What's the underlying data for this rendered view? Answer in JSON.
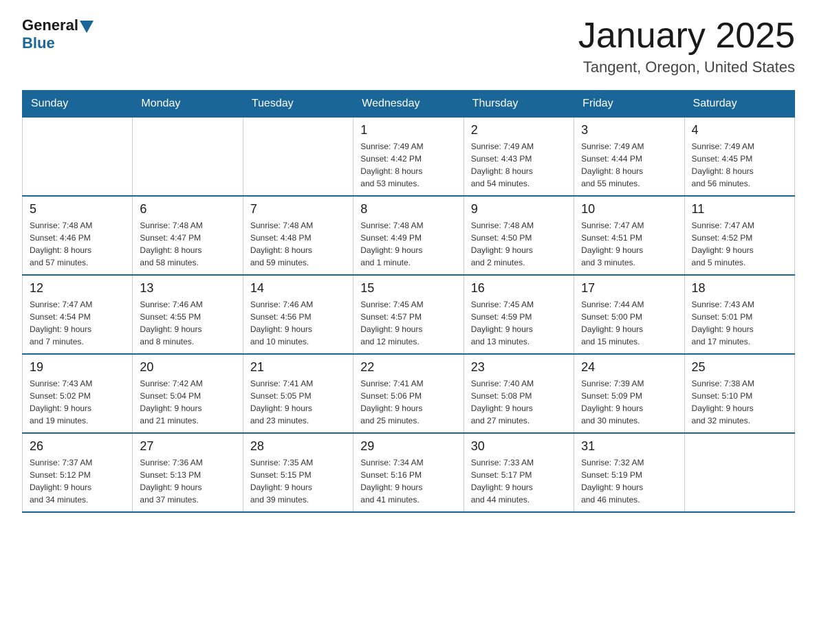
{
  "logo": {
    "general": "General",
    "blue": "Blue"
  },
  "title": "January 2025",
  "subtitle": "Tangent, Oregon, United States",
  "days_header": [
    "Sunday",
    "Monday",
    "Tuesday",
    "Wednesday",
    "Thursday",
    "Friday",
    "Saturday"
  ],
  "weeks": [
    [
      {
        "day": "",
        "info": ""
      },
      {
        "day": "",
        "info": ""
      },
      {
        "day": "",
        "info": ""
      },
      {
        "day": "1",
        "info": "Sunrise: 7:49 AM\nSunset: 4:42 PM\nDaylight: 8 hours\nand 53 minutes."
      },
      {
        "day": "2",
        "info": "Sunrise: 7:49 AM\nSunset: 4:43 PM\nDaylight: 8 hours\nand 54 minutes."
      },
      {
        "day": "3",
        "info": "Sunrise: 7:49 AM\nSunset: 4:44 PM\nDaylight: 8 hours\nand 55 minutes."
      },
      {
        "day": "4",
        "info": "Sunrise: 7:49 AM\nSunset: 4:45 PM\nDaylight: 8 hours\nand 56 minutes."
      }
    ],
    [
      {
        "day": "5",
        "info": "Sunrise: 7:48 AM\nSunset: 4:46 PM\nDaylight: 8 hours\nand 57 minutes."
      },
      {
        "day": "6",
        "info": "Sunrise: 7:48 AM\nSunset: 4:47 PM\nDaylight: 8 hours\nand 58 minutes."
      },
      {
        "day": "7",
        "info": "Sunrise: 7:48 AM\nSunset: 4:48 PM\nDaylight: 8 hours\nand 59 minutes."
      },
      {
        "day": "8",
        "info": "Sunrise: 7:48 AM\nSunset: 4:49 PM\nDaylight: 9 hours\nand 1 minute."
      },
      {
        "day": "9",
        "info": "Sunrise: 7:48 AM\nSunset: 4:50 PM\nDaylight: 9 hours\nand 2 minutes."
      },
      {
        "day": "10",
        "info": "Sunrise: 7:47 AM\nSunset: 4:51 PM\nDaylight: 9 hours\nand 3 minutes."
      },
      {
        "day": "11",
        "info": "Sunrise: 7:47 AM\nSunset: 4:52 PM\nDaylight: 9 hours\nand 5 minutes."
      }
    ],
    [
      {
        "day": "12",
        "info": "Sunrise: 7:47 AM\nSunset: 4:54 PM\nDaylight: 9 hours\nand 7 minutes."
      },
      {
        "day": "13",
        "info": "Sunrise: 7:46 AM\nSunset: 4:55 PM\nDaylight: 9 hours\nand 8 minutes."
      },
      {
        "day": "14",
        "info": "Sunrise: 7:46 AM\nSunset: 4:56 PM\nDaylight: 9 hours\nand 10 minutes."
      },
      {
        "day": "15",
        "info": "Sunrise: 7:45 AM\nSunset: 4:57 PM\nDaylight: 9 hours\nand 12 minutes."
      },
      {
        "day": "16",
        "info": "Sunrise: 7:45 AM\nSunset: 4:59 PM\nDaylight: 9 hours\nand 13 minutes."
      },
      {
        "day": "17",
        "info": "Sunrise: 7:44 AM\nSunset: 5:00 PM\nDaylight: 9 hours\nand 15 minutes."
      },
      {
        "day": "18",
        "info": "Sunrise: 7:43 AM\nSunset: 5:01 PM\nDaylight: 9 hours\nand 17 minutes."
      }
    ],
    [
      {
        "day": "19",
        "info": "Sunrise: 7:43 AM\nSunset: 5:02 PM\nDaylight: 9 hours\nand 19 minutes."
      },
      {
        "day": "20",
        "info": "Sunrise: 7:42 AM\nSunset: 5:04 PM\nDaylight: 9 hours\nand 21 minutes."
      },
      {
        "day": "21",
        "info": "Sunrise: 7:41 AM\nSunset: 5:05 PM\nDaylight: 9 hours\nand 23 minutes."
      },
      {
        "day": "22",
        "info": "Sunrise: 7:41 AM\nSunset: 5:06 PM\nDaylight: 9 hours\nand 25 minutes."
      },
      {
        "day": "23",
        "info": "Sunrise: 7:40 AM\nSunset: 5:08 PM\nDaylight: 9 hours\nand 27 minutes."
      },
      {
        "day": "24",
        "info": "Sunrise: 7:39 AM\nSunset: 5:09 PM\nDaylight: 9 hours\nand 30 minutes."
      },
      {
        "day": "25",
        "info": "Sunrise: 7:38 AM\nSunset: 5:10 PM\nDaylight: 9 hours\nand 32 minutes."
      }
    ],
    [
      {
        "day": "26",
        "info": "Sunrise: 7:37 AM\nSunset: 5:12 PM\nDaylight: 9 hours\nand 34 minutes."
      },
      {
        "day": "27",
        "info": "Sunrise: 7:36 AM\nSunset: 5:13 PM\nDaylight: 9 hours\nand 37 minutes."
      },
      {
        "day": "28",
        "info": "Sunrise: 7:35 AM\nSunset: 5:15 PM\nDaylight: 9 hours\nand 39 minutes."
      },
      {
        "day": "29",
        "info": "Sunrise: 7:34 AM\nSunset: 5:16 PM\nDaylight: 9 hours\nand 41 minutes."
      },
      {
        "day": "30",
        "info": "Sunrise: 7:33 AM\nSunset: 5:17 PM\nDaylight: 9 hours\nand 44 minutes."
      },
      {
        "day": "31",
        "info": "Sunrise: 7:32 AM\nSunset: 5:19 PM\nDaylight: 9 hours\nand 46 minutes."
      },
      {
        "day": "",
        "info": ""
      }
    ]
  ]
}
